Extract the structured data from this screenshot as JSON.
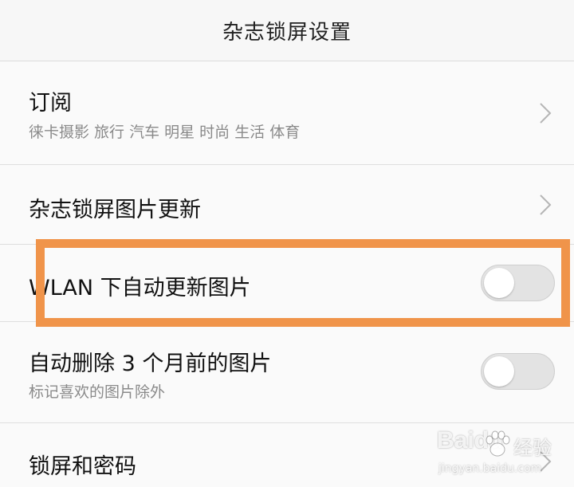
{
  "header": {
    "title": "杂志锁屏设置"
  },
  "rows": [
    {
      "title": "订阅",
      "subtitle": "徕卡摄影 旅行 汽车 明星 时尚 生活 体育",
      "control": "chevron-right-icon"
    },
    {
      "title": "杂志锁屏图片更新",
      "control": "chevron-right-icon"
    },
    {
      "title": "WLAN 下自动更新图片",
      "control": "toggle",
      "enabled": false
    },
    {
      "title": "自动删除 3 个月前的图片",
      "subtitle": "标记喜欢的图片除外",
      "control": "toggle",
      "enabled": false
    },
    {
      "title": "锁屏和密码",
      "control": "chevron-right-icon"
    }
  ],
  "watermark": {
    "brand": "Baidu",
    "text": "经验",
    "url": "jingyan.baidu.com"
  },
  "colors": {
    "highlight": "#f0944a",
    "background": "#f7f7f7",
    "toggle_off": "#e3e3e3"
  }
}
